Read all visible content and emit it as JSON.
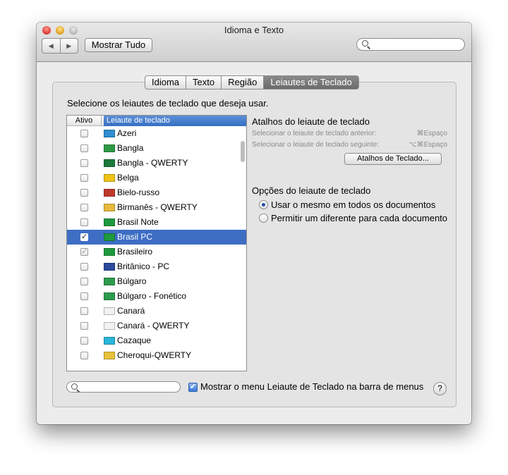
{
  "window": {
    "title": "Idioma e Texto"
  },
  "toolbar": {
    "back_icon": "◀",
    "forward_icon": "▶",
    "show_all_label": "Mostrar Tudo",
    "search_value": ""
  },
  "tabs": [
    "Idioma",
    "Texto",
    "Região",
    "Leiautes de Teclado"
  ],
  "instructions": "Selecione os leiautes de teclado que deseja usar.",
  "table": {
    "headers": {
      "active": "Ativo",
      "layout": "Leiaute de teclado"
    },
    "rows": [
      {
        "label": "Azeri",
        "checked": false,
        "flag": "#2f8fd0"
      },
      {
        "label": "Bangla",
        "checked": false,
        "flag": "#2e9a45"
      },
      {
        "label": "Bangla - QWERTY",
        "checked": false,
        "flag": "#1c7a3a"
      },
      {
        "label": "Belga",
        "checked": false,
        "flag": "#f0c419"
      },
      {
        "label": "Bielo-russo",
        "checked": false,
        "flag": "#c0392b"
      },
      {
        "label": "Birmanês - QWERTY",
        "checked": false,
        "flag": "#e6b93b"
      },
      {
        "label": "Brasil Note",
        "checked": false,
        "flag": "#1e9a3e"
      },
      {
        "label": "Brasil PC",
        "checked": true,
        "flag": "#1e9a3e"
      },
      {
        "label": "Brasileiro",
        "checked": true,
        "flag": "#1e9a3e"
      },
      {
        "label": "Britânico - PC",
        "checked": false,
        "flag": "#2b4a9b"
      },
      {
        "label": "Búlgaro",
        "checked": false,
        "flag": "#2d9b4e"
      },
      {
        "label": "Búlgaro - Fonético",
        "checked": false,
        "flag": "#2d9b4e"
      },
      {
        "label": "Canará",
        "checked": false,
        "flag": "#f2f2f2"
      },
      {
        "label": "Canará - QWERTY",
        "checked": false,
        "flag": "#f2f2f2"
      },
      {
        "label": "Cazaque",
        "checked": false,
        "flag": "#29b6d8"
      },
      {
        "label": "Cheroqui-QWERTY",
        "checked": false,
        "flag": "#e8c33a"
      }
    ]
  },
  "shortcuts": {
    "heading": "Atalhos do leiaute de teclado",
    "previous_label": "Selecionar o leiaute de teclado anterior:",
    "previous_key": "⌘Espaço",
    "next_label": "Selecionar o leiaute de teclado seguinte:",
    "next_key": "⌥⌘Espaço",
    "button_label": "Atalhos de Teclado..."
  },
  "options": {
    "heading": "Opções do leiaute de teclado",
    "radio_same": "Usar o mesmo em todos os documentos",
    "radio_different": "Permitir um diferente para cada documento",
    "selected": "same"
  },
  "footer": {
    "search_value": "",
    "show_menu_label": "Mostrar o menu Leiaute de Teclado na barra de menus",
    "show_menu_checked": true,
    "help_label": "?"
  }
}
